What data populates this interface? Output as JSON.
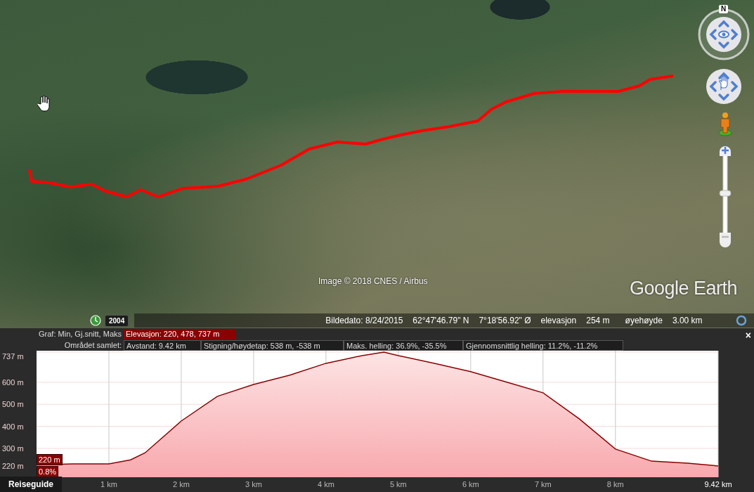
{
  "map": {
    "compass_label": "N",
    "attribution": "Image © 2018 CNES / Airbus",
    "logo": "Google Earth",
    "zoom_slider": {
      "level": 0.5
    }
  },
  "status_bar": {
    "year_button": "2004",
    "items": [
      {
        "kind": "text",
        "text": "Bildedato: 8/24/2015"
      },
      {
        "kind": "text",
        "text": "62°47'46.79\" N"
      },
      {
        "kind": "text",
        "text": "7°18'56.92\" Ø"
      },
      {
        "kind": "text",
        "text": "elevasjon"
      },
      {
        "kind": "text",
        "text": "254 m"
      },
      {
        "kind": "text",
        "text": "øyehøyde"
      },
      {
        "kind": "text",
        "text": "3.00 km"
      }
    ]
  },
  "profile": {
    "graph_label": "Graf: Min, Gj.snitt, Maks",
    "graph_value": "Elevasjon: 220, 478, 737 m",
    "summary_label": "Området samlet:",
    "summary": [
      "Avstand: 9.42 km",
      "Stigning/høydetap: 538 m, -538 m",
      "Maks. helling: 36.9%, -35.5%",
      "Gjennomsnittlig helling: 11.2%, -11.2%"
    ],
    "close": "×",
    "cursor_tags": [
      "220 m",
      "0.8%"
    ],
    "chart_data": {
      "type": "area",
      "x": [
        0,
        0.5,
        1,
        1.3,
        1.5,
        2,
        2.5,
        3,
        3.5,
        4,
        4.5,
        4.8,
        5,
        5.5,
        6,
        6.5,
        7,
        7.5,
        8,
        8.5,
        9,
        9.42
      ],
      "grid": true,
      "series": [
        {
          "color": "#8b0000",
          "values": [
            225,
            230,
            230,
            248,
            280,
            424,
            536,
            590,
            632,
            686,
            721,
            737,
            721,
            686,
            648,
            600,
            552,
            434,
            297,
            242,
            233,
            220
          ]
        }
      ],
      "xlim": [
        0,
        9.42
      ],
      "ylim": [
        169,
        743
      ],
      "xticks": [
        {
          "value": 1,
          "label": "1 km"
        },
        {
          "value": 2,
          "label": "2 km"
        },
        {
          "value": 3,
          "label": "3 km"
        },
        {
          "value": 4,
          "label": "4 km"
        },
        {
          "value": 5,
          "label": "5 km"
        },
        {
          "value": 6,
          "label": "6 km"
        },
        {
          "value": 7,
          "label": "7 km"
        },
        {
          "value": 8,
          "label": "8 km"
        },
        {
          "value": 9.42,
          "label": "9.42 km"
        }
      ],
      "yticks": [
        {
          "value": 220,
          "label": "220 m"
        },
        {
          "value": 300,
          "label": "300 m"
        },
        {
          "value": 400,
          "label": "400 m"
        },
        {
          "value": 500,
          "label": "500 m"
        },
        {
          "value": 600,
          "label": "600 m"
        },
        {
          "value": 737,
          "label": "737 m"
        }
      ]
    }
  },
  "guide_tab": {
    "label": "Reiseguide"
  }
}
